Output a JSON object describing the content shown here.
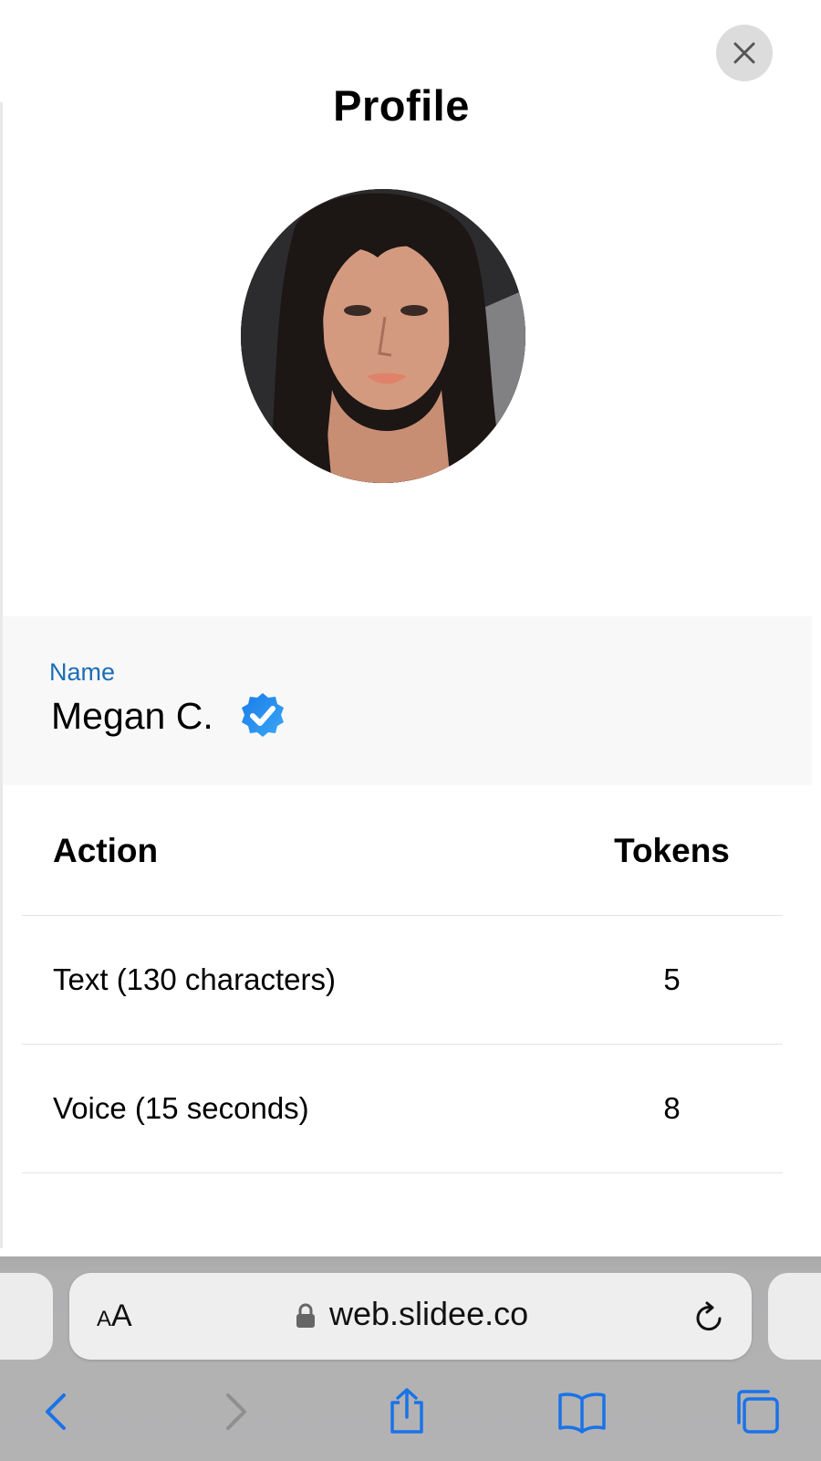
{
  "page": {
    "title": "Profile"
  },
  "profile": {
    "name_label": "Name",
    "name": "Megan C.",
    "verified_color": "#1f8ef1"
  },
  "table": {
    "headers": {
      "action": "Action",
      "tokens": "Tokens"
    },
    "rows": [
      {
        "action": "Text (130 characters)",
        "tokens": "5"
      },
      {
        "action": "Voice (15 seconds)",
        "tokens": "8"
      }
    ]
  },
  "browser": {
    "text_size_button": {
      "small": "A",
      "large": "A"
    },
    "url": "web.slidee.co",
    "accent_color": "#1a73e8",
    "icons": [
      "close-icon",
      "lock-icon",
      "reload-icon",
      "back-icon",
      "forward-icon",
      "share-icon",
      "bookmarks-icon",
      "tabs-icon"
    ]
  }
}
